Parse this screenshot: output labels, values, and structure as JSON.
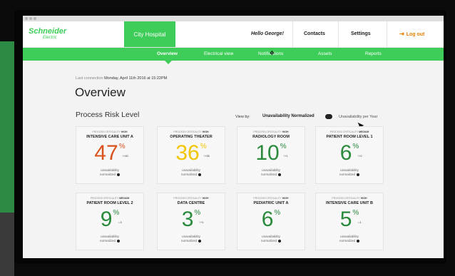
{
  "header": {
    "logo_line1": "Schneider",
    "logo_line2": "Electric",
    "site": "City Hospital",
    "greeting": "Hello George!",
    "contacts": "Contacts",
    "settings": "Settings",
    "logout": "Log out"
  },
  "subnav": {
    "items": [
      "Overview",
      "Electrical view",
      "Notifications",
      "Assets",
      "Reports"
    ],
    "active": "Overview"
  },
  "main": {
    "last_connection_label": "Last connection",
    "last_connection_value": "Monday, April 11th 2016 at 15:22PM",
    "title": "Overview",
    "section_title": "Process Risk Level",
    "view_by_label": "View by:",
    "option_selected": "Unavailability Normalized",
    "option_other": "Unavailability per Year"
  },
  "cards": [
    {
      "crit_label": "PROCESS CRITICALITY",
      "crit": "HIGH",
      "name": "INTENSIVE CARE UNIT A",
      "value": "47",
      "unit": "%",
      "trend": "↑+40",
      "note1": "unavailability",
      "note2": "normalized",
      "color": "#d9531e"
    },
    {
      "crit_label": "PROCESS CRITICALITY",
      "crit": "HIGH",
      "name": "OPERATING THEATER",
      "value": "36",
      "unit": "%",
      "trend": "↑+35",
      "note1": "unavailability",
      "note2": "normalized",
      "color": "#f2c500"
    },
    {
      "crit_label": "PROCESS CRITICALITY",
      "crit": "HIGH",
      "name": "RADIOLOGY ROOM",
      "value": "10",
      "unit": "%",
      "trend": "↑+1",
      "note1": "unavailability",
      "note2": "normalized",
      "color": "#2a8a3c"
    },
    {
      "crit_label": "PROCESS CRITICALITY",
      "crit": "MEDIUM",
      "name": "PATIENT ROOM LEVEL 1",
      "value": "6",
      "unit": "%",
      "trend": "↑+2",
      "note1": "unavailability",
      "note2": "normalized",
      "color": "#2a8a3c"
    },
    {
      "crit_label": "PROCESS CRITICALITY",
      "crit": "MEDIUM",
      "name": "PATIENT ROOM LEVEL 2",
      "value": "9",
      "unit": "%",
      "trend": "↓-3",
      "note1": "unavailability",
      "note2": "normalized",
      "color": "#2a8a3c"
    },
    {
      "crit_label": "PROCESS CRITICALITY",
      "crit": "HIGH",
      "name": "DATA CENTRE",
      "value": "3",
      "unit": "%",
      "trend": "↑+1",
      "note1": "unavailability",
      "note2": "normalized",
      "color": "#2a8a3c"
    },
    {
      "crit_label": "PROCESS CRITICALITY",
      "crit": "HIGH",
      "name": "PEDIATRIC UNIT A",
      "value": "6",
      "unit": "%",
      "trend": "",
      "note1": "unavailability",
      "note2": "normalized",
      "color": "#2a8a3c"
    },
    {
      "crit_label": "PROCESS CRITICALITY",
      "crit": "HIGH",
      "name": "INTENSIVE CARE UNIT B",
      "value": "5",
      "unit": "%",
      "trend": "↓-1",
      "note1": "unavailability",
      "note2": "normalized",
      "color": "#2a8a3c"
    }
  ],
  "colors": {
    "brand_green": "#3dcd58",
    "logout_orange": "#e47f00"
  }
}
